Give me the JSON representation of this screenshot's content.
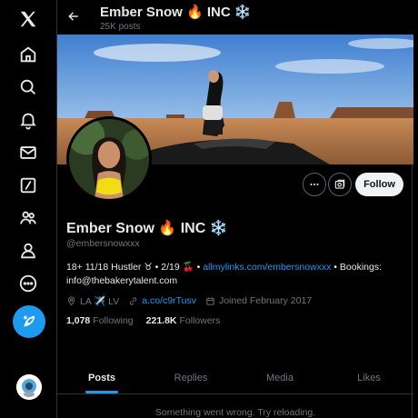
{
  "rail": {
    "items": [
      "x-logo",
      "home",
      "explore",
      "notifications",
      "messages",
      "grok",
      "communities",
      "profile",
      "more"
    ]
  },
  "header": {
    "name": "Ember Snow 🔥 INC ❄️",
    "post_count": "25K posts"
  },
  "profile": {
    "display_name": "Ember Snow 🔥 INC ❄️",
    "handle": "@embersnowxxx",
    "bio_before_link": "18+ 11/18 Hustler ♉ • 2/19 🍒 • ",
    "bio_link": "allmylinks.com/embersnowxxx",
    "bio_after_link": " • Bookings: info@thebakerytalent.com",
    "location": "LA ✈️ LV",
    "website": "a.co/c9rTusv",
    "joined": "Joined February 2017",
    "following_count": "1,078",
    "following_label": "Following",
    "followers_count": "221.8K",
    "followers_label": "Followers"
  },
  "actions": {
    "follow_label": "Follow"
  },
  "tabs": [
    {
      "label": "Posts",
      "active": true
    },
    {
      "label": "Replies",
      "active": false
    },
    {
      "label": "Media",
      "active": false
    },
    {
      "label": "Likes",
      "active": false
    }
  ],
  "feed": {
    "error": "Something went wrong. Try reloading."
  },
  "colors": {
    "accent": "#1d9bf0",
    "background": "#000000",
    "muted_text": "#71767b"
  }
}
